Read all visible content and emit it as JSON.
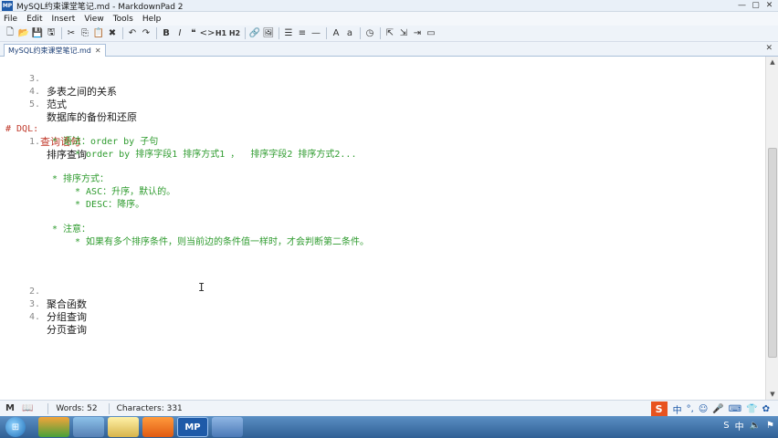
{
  "window": {
    "title": "MySQL约束课堂笔记.md - MarkdownPad 2",
    "app_icon": "MP",
    "controls": [
      "—",
      "▢",
      "✕"
    ]
  },
  "menu": [
    "File",
    "Edit",
    "Insert",
    "View",
    "Tools",
    "Help"
  ],
  "toolbar": {
    "h1": "H1",
    "h2": "H2"
  },
  "tab": {
    "label": "MySQL约束课堂笔记.md",
    "close": "✕"
  },
  "editor": {
    "lines": [
      {
        "num": "3.",
        "text": "多表之间的关系"
      },
      {
        "num": "4.",
        "text": "范式"
      },
      {
        "num": "5.",
        "text": "数据库的备份和还原"
      },
      {
        "heading_prefix": "# DQL:",
        "heading_text": "查询语句"
      },
      {
        "num": "1.",
        "text": "排序查询"
      },
      {
        "bullet": "* 语法：order by 子句"
      },
      {
        "bullet": "* order by 排序字段1 排序方式1 ，  排序字段2 排序方式2..."
      },
      {
        "bullet": "* 排序方式："
      },
      {
        "bullet": "* ASC：升序，默认的。"
      },
      {
        "bullet": "* DESC：降序。"
      },
      {
        "bullet": "* 注意："
      },
      {
        "bullet": "* 如果有多个排序条件，则当前边的条件值一样时，才会判断第二条件。"
      },
      {
        "num": "2.",
        "text": "聚合函数"
      },
      {
        "num": "3.",
        "text": "分组查询"
      },
      {
        "num": "4.",
        "text": "分页查询"
      }
    ]
  },
  "status": {
    "mode_icon": "M",
    "words": "Words: 52",
    "characters": "Characters: 331",
    "ime_logo": "S",
    "ime_items": [
      "中",
      "°,",
      "☺",
      "🎤",
      "⌨",
      "👕",
      "✿"
    ]
  },
  "taskbar": {
    "apps": [
      "",
      "",
      "",
      "",
      "MP",
      ""
    ],
    "tray": [
      "S",
      "中",
      "🔈",
      "⚑"
    ]
  },
  "colors": {
    "heading": "#c0392b",
    "green": "#2e9b2e",
    "accent": "#1e5aa8"
  }
}
